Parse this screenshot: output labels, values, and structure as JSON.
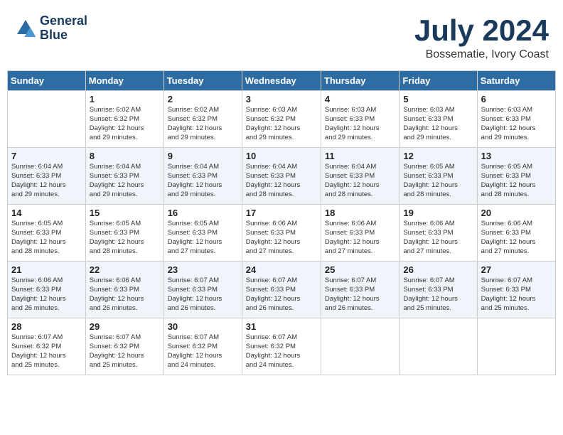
{
  "header": {
    "logo_line1": "General",
    "logo_line2": "Blue",
    "month_year": "July 2024",
    "location": "Bossematie, Ivory Coast"
  },
  "weekdays": [
    "Sunday",
    "Monday",
    "Tuesday",
    "Wednesday",
    "Thursday",
    "Friday",
    "Saturday"
  ],
  "weeks": [
    [
      {
        "day": "",
        "info": ""
      },
      {
        "day": "1",
        "info": "Sunrise: 6:02 AM\nSunset: 6:32 PM\nDaylight: 12 hours\nand 29 minutes."
      },
      {
        "day": "2",
        "info": "Sunrise: 6:02 AM\nSunset: 6:32 PM\nDaylight: 12 hours\nand 29 minutes."
      },
      {
        "day": "3",
        "info": "Sunrise: 6:03 AM\nSunset: 6:32 PM\nDaylight: 12 hours\nand 29 minutes."
      },
      {
        "day": "4",
        "info": "Sunrise: 6:03 AM\nSunset: 6:33 PM\nDaylight: 12 hours\nand 29 minutes."
      },
      {
        "day": "5",
        "info": "Sunrise: 6:03 AM\nSunset: 6:33 PM\nDaylight: 12 hours\nand 29 minutes."
      },
      {
        "day": "6",
        "info": "Sunrise: 6:03 AM\nSunset: 6:33 PM\nDaylight: 12 hours\nand 29 minutes."
      }
    ],
    [
      {
        "day": "7",
        "info": "Sunrise: 6:04 AM\nSunset: 6:33 PM\nDaylight: 12 hours\nand 29 minutes."
      },
      {
        "day": "8",
        "info": "Sunrise: 6:04 AM\nSunset: 6:33 PM\nDaylight: 12 hours\nand 29 minutes."
      },
      {
        "day": "9",
        "info": "Sunrise: 6:04 AM\nSunset: 6:33 PM\nDaylight: 12 hours\nand 29 minutes."
      },
      {
        "day": "10",
        "info": "Sunrise: 6:04 AM\nSunset: 6:33 PM\nDaylight: 12 hours\nand 28 minutes."
      },
      {
        "day": "11",
        "info": "Sunrise: 6:04 AM\nSunset: 6:33 PM\nDaylight: 12 hours\nand 28 minutes."
      },
      {
        "day": "12",
        "info": "Sunrise: 6:05 AM\nSunset: 6:33 PM\nDaylight: 12 hours\nand 28 minutes."
      },
      {
        "day": "13",
        "info": "Sunrise: 6:05 AM\nSunset: 6:33 PM\nDaylight: 12 hours\nand 28 minutes."
      }
    ],
    [
      {
        "day": "14",
        "info": "Sunrise: 6:05 AM\nSunset: 6:33 PM\nDaylight: 12 hours\nand 28 minutes."
      },
      {
        "day": "15",
        "info": "Sunrise: 6:05 AM\nSunset: 6:33 PM\nDaylight: 12 hours\nand 28 minutes."
      },
      {
        "day": "16",
        "info": "Sunrise: 6:05 AM\nSunset: 6:33 PM\nDaylight: 12 hours\nand 27 minutes."
      },
      {
        "day": "17",
        "info": "Sunrise: 6:06 AM\nSunset: 6:33 PM\nDaylight: 12 hours\nand 27 minutes."
      },
      {
        "day": "18",
        "info": "Sunrise: 6:06 AM\nSunset: 6:33 PM\nDaylight: 12 hours\nand 27 minutes."
      },
      {
        "day": "19",
        "info": "Sunrise: 6:06 AM\nSunset: 6:33 PM\nDaylight: 12 hours\nand 27 minutes."
      },
      {
        "day": "20",
        "info": "Sunrise: 6:06 AM\nSunset: 6:33 PM\nDaylight: 12 hours\nand 27 minutes."
      }
    ],
    [
      {
        "day": "21",
        "info": "Sunrise: 6:06 AM\nSunset: 6:33 PM\nDaylight: 12 hours\nand 26 minutes."
      },
      {
        "day": "22",
        "info": "Sunrise: 6:06 AM\nSunset: 6:33 PM\nDaylight: 12 hours\nand 26 minutes."
      },
      {
        "day": "23",
        "info": "Sunrise: 6:07 AM\nSunset: 6:33 PM\nDaylight: 12 hours\nand 26 minutes."
      },
      {
        "day": "24",
        "info": "Sunrise: 6:07 AM\nSunset: 6:33 PM\nDaylight: 12 hours\nand 26 minutes."
      },
      {
        "day": "25",
        "info": "Sunrise: 6:07 AM\nSunset: 6:33 PM\nDaylight: 12 hours\nand 26 minutes."
      },
      {
        "day": "26",
        "info": "Sunrise: 6:07 AM\nSunset: 6:33 PM\nDaylight: 12 hours\nand 25 minutes."
      },
      {
        "day": "27",
        "info": "Sunrise: 6:07 AM\nSunset: 6:33 PM\nDaylight: 12 hours\nand 25 minutes."
      }
    ],
    [
      {
        "day": "28",
        "info": "Sunrise: 6:07 AM\nSunset: 6:32 PM\nDaylight: 12 hours\nand 25 minutes."
      },
      {
        "day": "29",
        "info": "Sunrise: 6:07 AM\nSunset: 6:32 PM\nDaylight: 12 hours\nand 25 minutes."
      },
      {
        "day": "30",
        "info": "Sunrise: 6:07 AM\nSunset: 6:32 PM\nDaylight: 12 hours\nand 24 minutes."
      },
      {
        "day": "31",
        "info": "Sunrise: 6:07 AM\nSunset: 6:32 PM\nDaylight: 12 hours\nand 24 minutes."
      },
      {
        "day": "",
        "info": ""
      },
      {
        "day": "",
        "info": ""
      },
      {
        "day": "",
        "info": ""
      }
    ]
  ]
}
